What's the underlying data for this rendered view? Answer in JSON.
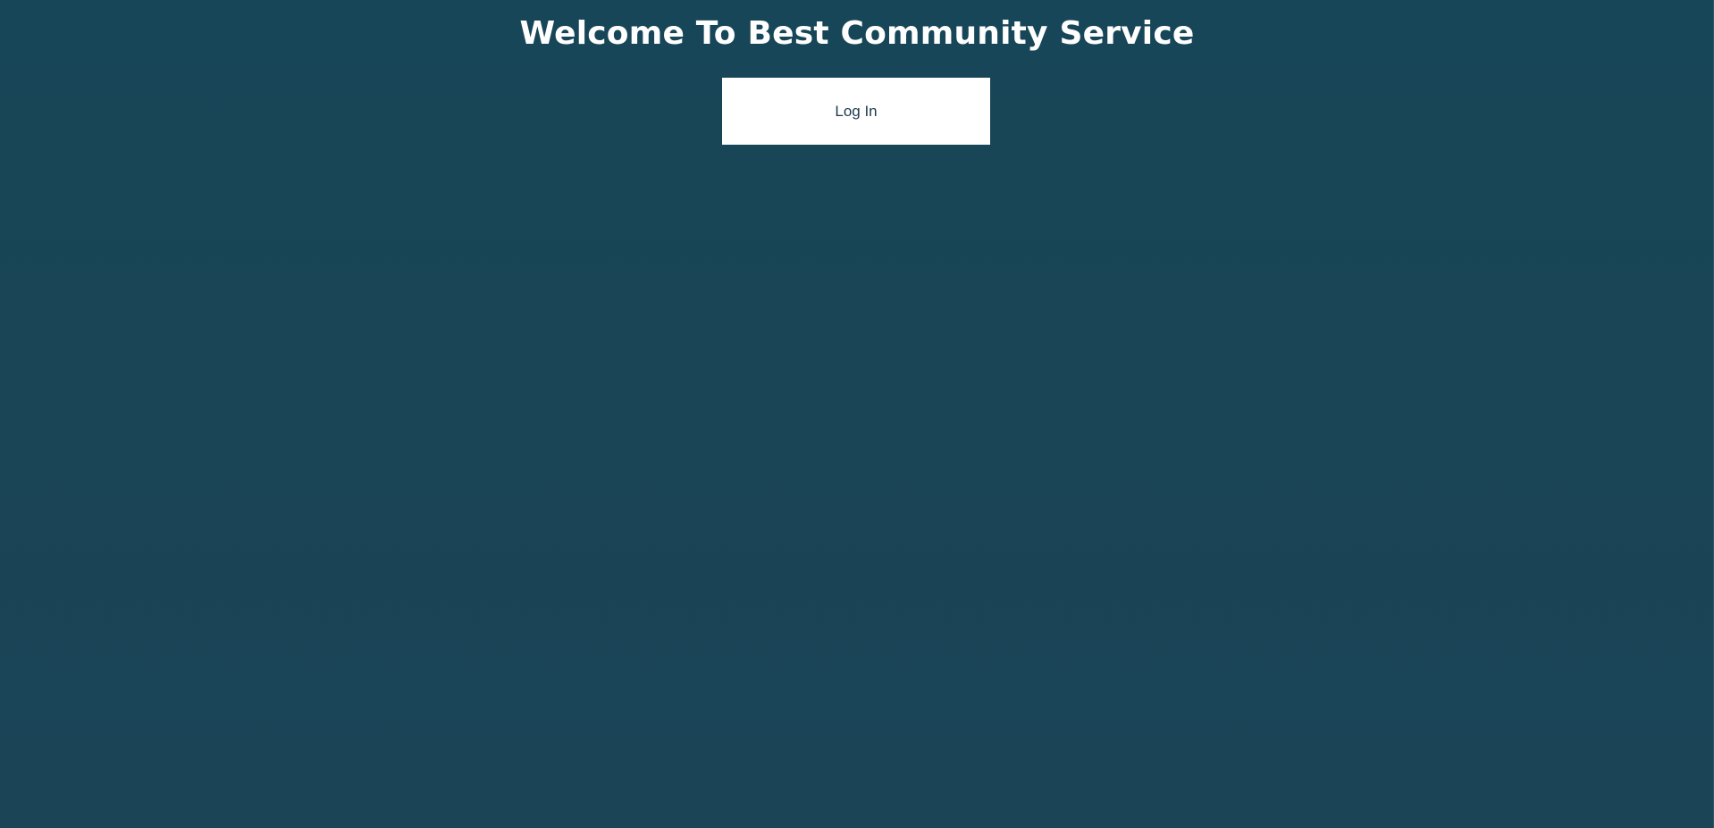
{
  "header": {
    "title": "Welcome To Best Community Service"
  },
  "login": {
    "button_label": "Log In"
  },
  "colors": {
    "background": "#194556",
    "title_text": "#ffffff",
    "button_background": "#ffffff",
    "button_text": "#1a3a4c"
  }
}
